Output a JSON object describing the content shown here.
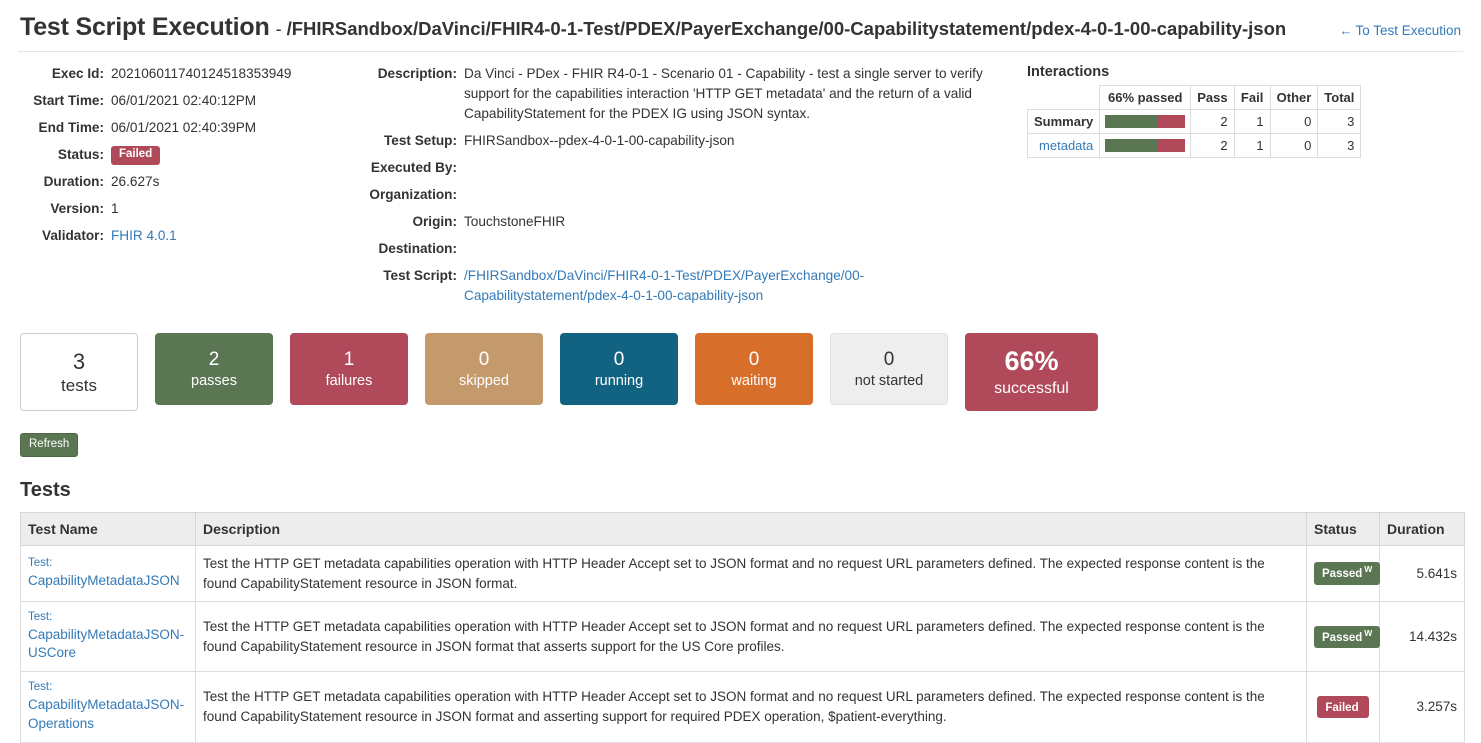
{
  "header": {
    "title": "Test Script Execution",
    "separator": "-",
    "path": "/FHIRSandbox/DaVinci/FHIR4-0-1-Test/PDEX/PayerExchange/00-Capabilitystatement/pdex-4-0-1-00-capability-json",
    "back_link": "To Test Execution",
    "back_arrow": "←"
  },
  "exec_info": {
    "exec_id_label": "Exec Id:",
    "exec_id": "202106011740124518353949",
    "start_time_label": "Start Time:",
    "start_time": "06/01/2021 02:40:12PM",
    "end_time_label": "End Time:",
    "end_time": "06/01/2021 02:40:39PM",
    "status_label": "Status:",
    "status": "Failed",
    "duration_label": "Duration:",
    "duration": "26.627s",
    "version_label": "Version:",
    "version": "1",
    "validator_label": "Validator:",
    "validator": "FHIR 4.0.1"
  },
  "details": {
    "description_label": "Description:",
    "description": "Da Vinci - PDex - FHIR R4-0-1 - Scenario 01 - Capability - test a single server to verify support for the capabilities interaction 'HTTP GET metadata' and the return of a valid CapabilityStatement for the PDEX IG using JSON syntax.",
    "test_setup_label": "Test Setup:",
    "test_setup": "FHIRSandbox--pdex-4-0-1-00-capability-json",
    "executed_by_label": "Executed By:",
    "executed_by": "",
    "organization_label": "Organization:",
    "organization": "",
    "origin_label": "Origin:",
    "origin": "TouchstoneFHIR",
    "destination_label": "Destination:",
    "destination": "",
    "test_script_label": "Test Script:",
    "test_script": "/FHIRSandbox/DaVinci/FHIR4-0-1-Test/PDEX/PayerExchange/00-Capabilitystatement/pdex-4-0-1-00-capability-json"
  },
  "interactions": {
    "title": "Interactions",
    "columns": [
      "",
      "66% passed",
      "Pass",
      "Fail",
      "Other",
      "Total"
    ],
    "rows": [
      {
        "label": "Summary",
        "is_link": false,
        "pass_pct": 66,
        "pass": "2",
        "fail": "1",
        "other": "0",
        "total": "3"
      },
      {
        "label": "metadata",
        "is_link": true,
        "pass_pct": 66,
        "pass": "2",
        "fail": "1",
        "other": "0",
        "total": "3"
      }
    ]
  },
  "stats": [
    {
      "value": "3",
      "label": "tests",
      "kind": "total"
    },
    {
      "value": "2",
      "label": "passes",
      "kind": "pass"
    },
    {
      "value": "1",
      "label": "failures",
      "kind": "fail"
    },
    {
      "value": "0",
      "label": "skipped",
      "kind": "skip"
    },
    {
      "value": "0",
      "label": "running",
      "kind": "running"
    },
    {
      "value": "0",
      "label": "waiting",
      "kind": "waiting"
    },
    {
      "value": "0",
      "label": "not started",
      "kind": "notstarted"
    },
    {
      "value": "66%",
      "label": "successful",
      "kind": "success"
    }
  ],
  "toolbar": {
    "refresh_label": "Refresh"
  },
  "tests_section": {
    "heading": "Tests",
    "columns": {
      "name": "Test Name",
      "description": "Description",
      "status": "Status",
      "duration": "Duration"
    },
    "rows": [
      {
        "prefix": "Test:",
        "name": "CapabilityMetadataJSON",
        "description": "Test the HTTP GET metadata capabilities operation with HTTP Header Accept set to JSON format and no request URL parameters defined. The expected response content is the found CapabilityStatement resource in JSON format.",
        "status": "Passed",
        "status_sup": "W",
        "status_kind": "passed",
        "duration": "5.641s"
      },
      {
        "prefix": "Test:",
        "name": "CapabilityMetadataJSON-USCore",
        "description": "Test the HTTP GET metadata capabilities operation with HTTP Header Accept set to JSON format and no request URL parameters defined. The expected response content is the found CapabilityStatement resource in JSON format that asserts support for the US Core profiles.",
        "status": "Passed",
        "status_sup": "W",
        "status_kind": "passed",
        "duration": "14.432s"
      },
      {
        "prefix": "Test:",
        "name": "CapabilityMetadataJSON-Operations",
        "description": "Test the HTTP GET metadata capabilities operation with HTTP Header Accept set to JSON format and no request URL parameters defined. The expected response content is the found CapabilityStatement resource in JSON format and asserting support for required PDEX operation, $patient-everything.",
        "status": "Failed",
        "status_sup": "",
        "status_kind": "failed",
        "duration": "3.257s"
      }
    ]
  },
  "colors": {
    "pass_green": "#5b7653",
    "fail_red": "#b04a5a",
    "skip_tan": "#c49a6c",
    "running_blue": "#126382",
    "waiting_orange": "#d76f2a",
    "notstarted_gray": "#eeeeee",
    "link_blue": "#337ab7"
  }
}
